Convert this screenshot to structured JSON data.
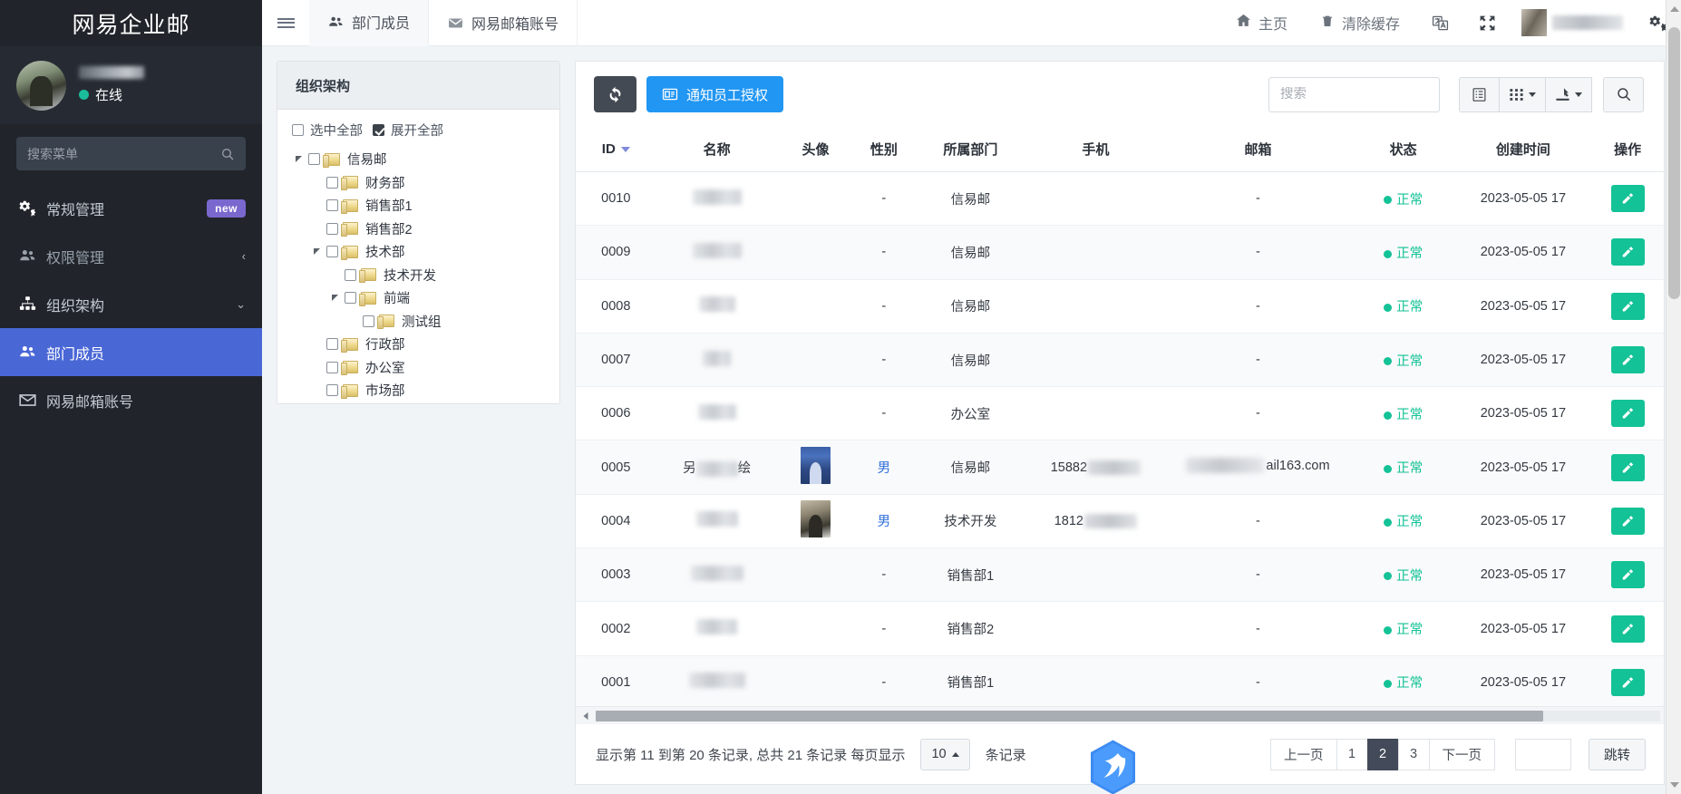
{
  "sidebar": {
    "brand": "网易企业邮",
    "profile": {
      "status": "在线",
      "status_color": "#1abc9c"
    },
    "search": {
      "placeholder": "搜索菜单",
      "value": "",
      "icon": "search-icon"
    },
    "items": [
      {
        "label": "常规管理",
        "icon": "gears-icon",
        "badge": "new",
        "state": "normal"
      },
      {
        "label": "权限管理",
        "icon": "users-icon",
        "chevron": "‹",
        "state": "dim"
      },
      {
        "label": "组织架构",
        "icon": "sitemap-icon",
        "chevron": "⌄",
        "state": "normal"
      },
      {
        "label": "部门成员",
        "icon": "users-icon",
        "state": "active"
      },
      {
        "label": "网易邮箱账号",
        "icon": "envelope-icon",
        "state": "normal"
      }
    ],
    "active_color": "#4a67d6",
    "badge_color": "#7a68cf"
  },
  "topbar": {
    "menu_toggle": "hamburger-icon",
    "tabs": [
      {
        "label": "部门成员",
        "icon": "users-icon",
        "selected": true
      },
      {
        "label": "网易邮箱账号",
        "icon": "envelope-icon",
        "selected": false
      }
    ],
    "actions": [
      {
        "label": "主页",
        "icon": "home-icon"
      },
      {
        "label": "清除缓存",
        "icon": "trash-icon"
      }
    ],
    "icon_buttons": [
      {
        "name": "translate-icon"
      },
      {
        "name": "fullscreen-icon"
      }
    ],
    "settings_icon": "gears-icon"
  },
  "org": {
    "title": "组织架构",
    "select_all": {
      "label": "选中全部",
      "checked": false
    },
    "expand_all": {
      "label": "展开全部",
      "checked": true
    },
    "tree": [
      {
        "label": "信易邮",
        "depth": 0,
        "expandable": true
      },
      {
        "label": "财务部",
        "depth": 1,
        "expandable": false
      },
      {
        "label": "销售部1",
        "depth": 1,
        "expandable": false
      },
      {
        "label": "销售部2",
        "depth": 1,
        "expandable": false
      },
      {
        "label": "技术部",
        "depth": 1,
        "expandable": true
      },
      {
        "label": "技术开发",
        "depth": 2,
        "expandable": false
      },
      {
        "label": "前端",
        "depth": 2,
        "expandable": true
      },
      {
        "label": "测试组",
        "depth": 3,
        "expandable": false
      },
      {
        "label": "行政部",
        "depth": 1,
        "expandable": false
      },
      {
        "label": "办公室",
        "depth": 1,
        "expandable": false
      },
      {
        "label": "市场部",
        "depth": 1,
        "expandable": false
      }
    ]
  },
  "toolbar": {
    "refresh_icon": "refresh-icon",
    "notify_label": "通知员工授权",
    "notify_icon": "id-card-icon",
    "notify_color": "#2196f3",
    "search": {
      "placeholder": "搜索",
      "value": ""
    },
    "buttons": [
      {
        "name": "list-view-button",
        "icon": "list-icon"
      },
      {
        "name": "columns-button",
        "icon": "grid-icon",
        "caret": true
      },
      {
        "name": "export-button",
        "icon": "export-icon",
        "caret": true
      },
      {
        "name": "search-button",
        "icon": "search-icon"
      }
    ]
  },
  "table": {
    "columns": [
      "ID",
      "名称",
      "头像",
      "性别",
      "所属部门",
      "手机",
      "邮箱",
      "状态",
      "创建时间",
      "操作"
    ],
    "sorted_column": "ID",
    "rows": [
      {
        "id": "0010",
        "name": "",
        "avatar": "",
        "gender": "-",
        "dept": "信易邮",
        "phone": "",
        "email": "-",
        "status": "正常",
        "created": "2023-05-05 17",
        "action": "edit"
      },
      {
        "id": "0009",
        "name": "",
        "avatar": "",
        "gender": "-",
        "dept": "信易邮",
        "phone": "",
        "email": "-",
        "status": "正常",
        "created": "2023-05-05 17",
        "action": "edit"
      },
      {
        "id": "0008",
        "name": "",
        "avatar": "",
        "gender": "-",
        "dept": "信易邮",
        "phone": "",
        "email": "-",
        "status": "正常",
        "created": "2023-05-05 17",
        "action": "edit"
      },
      {
        "id": "0007",
        "name": "",
        "avatar": "",
        "gender": "-",
        "dept": "信易邮",
        "phone": "",
        "email": "-",
        "status": "正常",
        "created": "2023-05-05 17",
        "action": "edit"
      },
      {
        "id": "0006",
        "name": "",
        "avatar": "",
        "gender": "-",
        "dept": "办公室",
        "phone": "",
        "email": "-",
        "status": "正常",
        "created": "2023-05-05 17",
        "action": "edit"
      },
      {
        "id": "0005",
        "name": "",
        "avatar": "photo",
        "gender": "男",
        "dept": "信易邮",
        "phone": "15882",
        "email": "ail163.com",
        "status": "正常",
        "created": "2023-05-05 17",
        "action": "edit"
      },
      {
        "id": "0004",
        "name": "",
        "avatar": "photo",
        "gender": "男",
        "dept": "技术开发",
        "phone": "1812",
        "email": "-",
        "status": "正常",
        "created": "2023-05-05 17",
        "action": "edit"
      },
      {
        "id": "0003",
        "name": "",
        "avatar": "",
        "gender": "-",
        "dept": "销售部1",
        "phone": "",
        "email": "-",
        "status": "正常",
        "created": "2023-05-05 17",
        "action": "edit"
      },
      {
        "id": "0002",
        "name": "",
        "avatar": "",
        "gender": "-",
        "dept": "销售部2",
        "phone": "",
        "email": "-",
        "status": "正常",
        "created": "2023-05-05 17",
        "action": "edit"
      },
      {
        "id": "0001",
        "name": "",
        "avatar": "",
        "gender": "-",
        "dept": "销售部1",
        "phone": "",
        "email": "-",
        "status": "正常",
        "created": "2023-05-05 17",
        "action": "edit"
      }
    ],
    "status_color": "#13c296"
  },
  "footer": {
    "summary_prefix": "显示第 11 到第 20 条记录, 总共 21 条记录 每页显示",
    "per_page": "10",
    "summary_suffix": "条记录",
    "pager": {
      "prev": "上一页",
      "pages": [
        "1",
        "2",
        "3"
      ],
      "active_page": "2",
      "next": "下一页",
      "jump_value": "",
      "jump_label": "跳转"
    }
  }
}
